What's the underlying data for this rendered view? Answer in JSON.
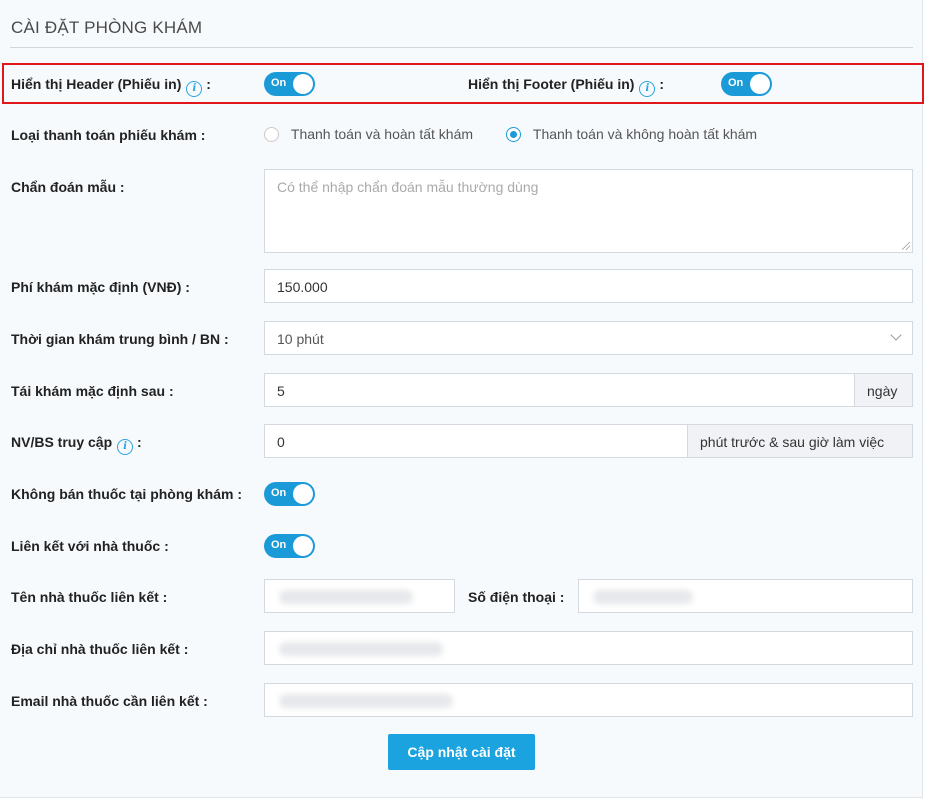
{
  "page": {
    "title": "CÀI ĐẶT PHÒNG KHÁM"
  },
  "print": {
    "header_label": "Hiển thị Header (Phiếu in)",
    "header_toggle": "On",
    "footer_label": "Hiển thị Footer (Phiếu in)",
    "footer_toggle": "On"
  },
  "payment": {
    "label": "Loại thanh toán phiếu khám",
    "option_1": "Thanh toán và hoàn tất khám",
    "option_2": "Thanh toán và không hoàn tất khám",
    "selected": "option_2"
  },
  "diagnosis": {
    "label": "Chẩn đoán mẫu",
    "placeholder": "Có thể nhập chẩn đoán mẫu thường dùng"
  },
  "fee": {
    "label": "Phí khám mặc định (VNĐ)",
    "value": "150.000"
  },
  "avg_time": {
    "label": "Thời gian khám trung bình / BN",
    "value": "10 phút"
  },
  "revisit": {
    "label": "Tái khám mặc định sau",
    "value": "5",
    "unit": "ngày"
  },
  "access": {
    "label": "NV/BS truy cập",
    "value": "0",
    "unit": "phút trước & sau giờ làm việc"
  },
  "no_sell": {
    "label": "Không bán thuốc tại phòng khám",
    "toggle": "On"
  },
  "link_pharmacy": {
    "label": "Liên kết với nhà thuốc",
    "toggle": "On"
  },
  "pharmacy_name": {
    "label": "Tên nhà thuốc liên kết"
  },
  "phone": {
    "label": "Số điện thoại"
  },
  "pharmacy_address": {
    "label": "Địa chỉ nhà thuốc liên kết"
  },
  "pharmacy_email": {
    "label": "Email nhà thuốc cần liên kết"
  },
  "actions": {
    "update_label": "Cập nhật cài đặt"
  },
  "colors": {
    "accent": "#1a9ad6",
    "highlight_border": "#e0161b",
    "button": "#1aa3df"
  },
  "icons": {
    "info": "info-circle-icon",
    "select": "chevron-down-icon"
  }
}
